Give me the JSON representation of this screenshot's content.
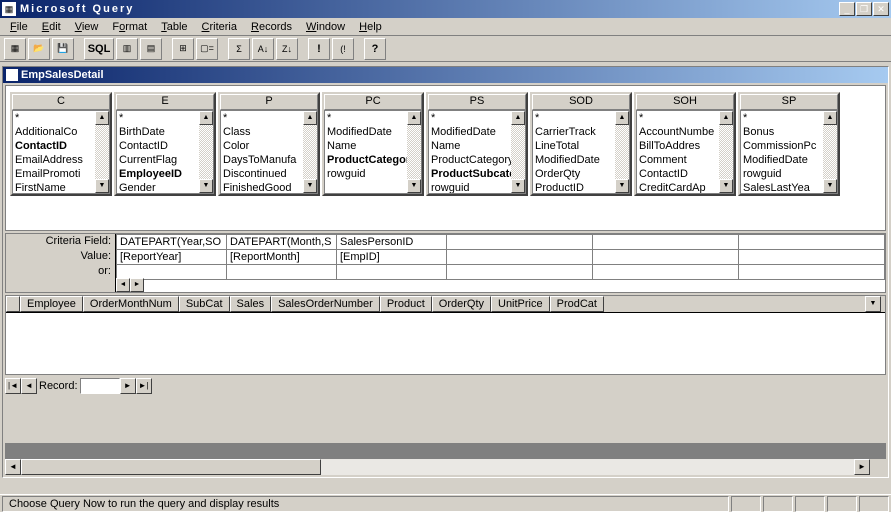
{
  "app": {
    "title": "Microsoft Query"
  },
  "menus": [
    "File",
    "Edit",
    "View",
    "Format",
    "Table",
    "Criteria",
    "Records",
    "Window",
    "Help"
  ],
  "child": {
    "title": "EmpSalesDetail"
  },
  "tables": [
    {
      "name": "C",
      "fields": [
        "*",
        "AdditionalCo",
        "ContactID",
        "EmailAddress",
        "EmailPromoti",
        "FirstName"
      ],
      "bold": [
        2
      ]
    },
    {
      "name": "E",
      "fields": [
        "*",
        "BirthDate",
        "ContactID",
        "CurrentFlag",
        "EmployeeID",
        "Gender"
      ],
      "bold": [
        4
      ]
    },
    {
      "name": "P",
      "fields": [
        "*",
        "Class",
        "Color",
        "DaysToManufa",
        "Discontinued",
        "FinishedGood"
      ],
      "bold": []
    },
    {
      "name": "PC",
      "fields": [
        "*",
        "ModifiedDate",
        "Name",
        "ProductCategory",
        "rowguid"
      ],
      "bold": [
        3
      ]
    },
    {
      "name": "PS",
      "fields": [
        "*",
        "ModifiedDate",
        "Name",
        "ProductCategory",
        "ProductSubcateg",
        "rowguid"
      ],
      "bold": [
        4
      ]
    },
    {
      "name": "SOD",
      "fields": [
        "*",
        "CarrierTrack",
        "LineTotal",
        "ModifiedDate",
        "OrderQty",
        "ProductID"
      ],
      "bold": []
    },
    {
      "name": "SOH",
      "fields": [
        "*",
        "AccountNumbe",
        "BillToAddres",
        "Comment",
        "ContactID",
        "CreditCardAp"
      ],
      "bold": []
    },
    {
      "name": "SP",
      "fields": [
        "*",
        "Bonus",
        "CommissionPc",
        "ModifiedDate",
        "rowguid",
        "SalesLastYea"
      ],
      "bold": []
    }
  ],
  "criteria": {
    "labels": {
      "field": "Criteria Field:",
      "value": "Value:",
      "or": "or:"
    },
    "cols": [
      {
        "field": "DATEPART(Year,SO",
        "value": "[ReportYear]"
      },
      {
        "field": "DATEPART(Month,S",
        "value": "[ReportMonth]"
      },
      {
        "field": "SalesPersonID",
        "value": "[EmpID]"
      }
    ]
  },
  "resultCols": [
    "Employee",
    "OrderMonthNum",
    "SubCat",
    "Sales",
    "SalesOrderNumber",
    "Product",
    "OrderQty",
    "UnitPrice",
    "ProdCat"
  ],
  "nav": {
    "label": "Record:"
  },
  "status": "Choose Query Now to run the query and display results"
}
